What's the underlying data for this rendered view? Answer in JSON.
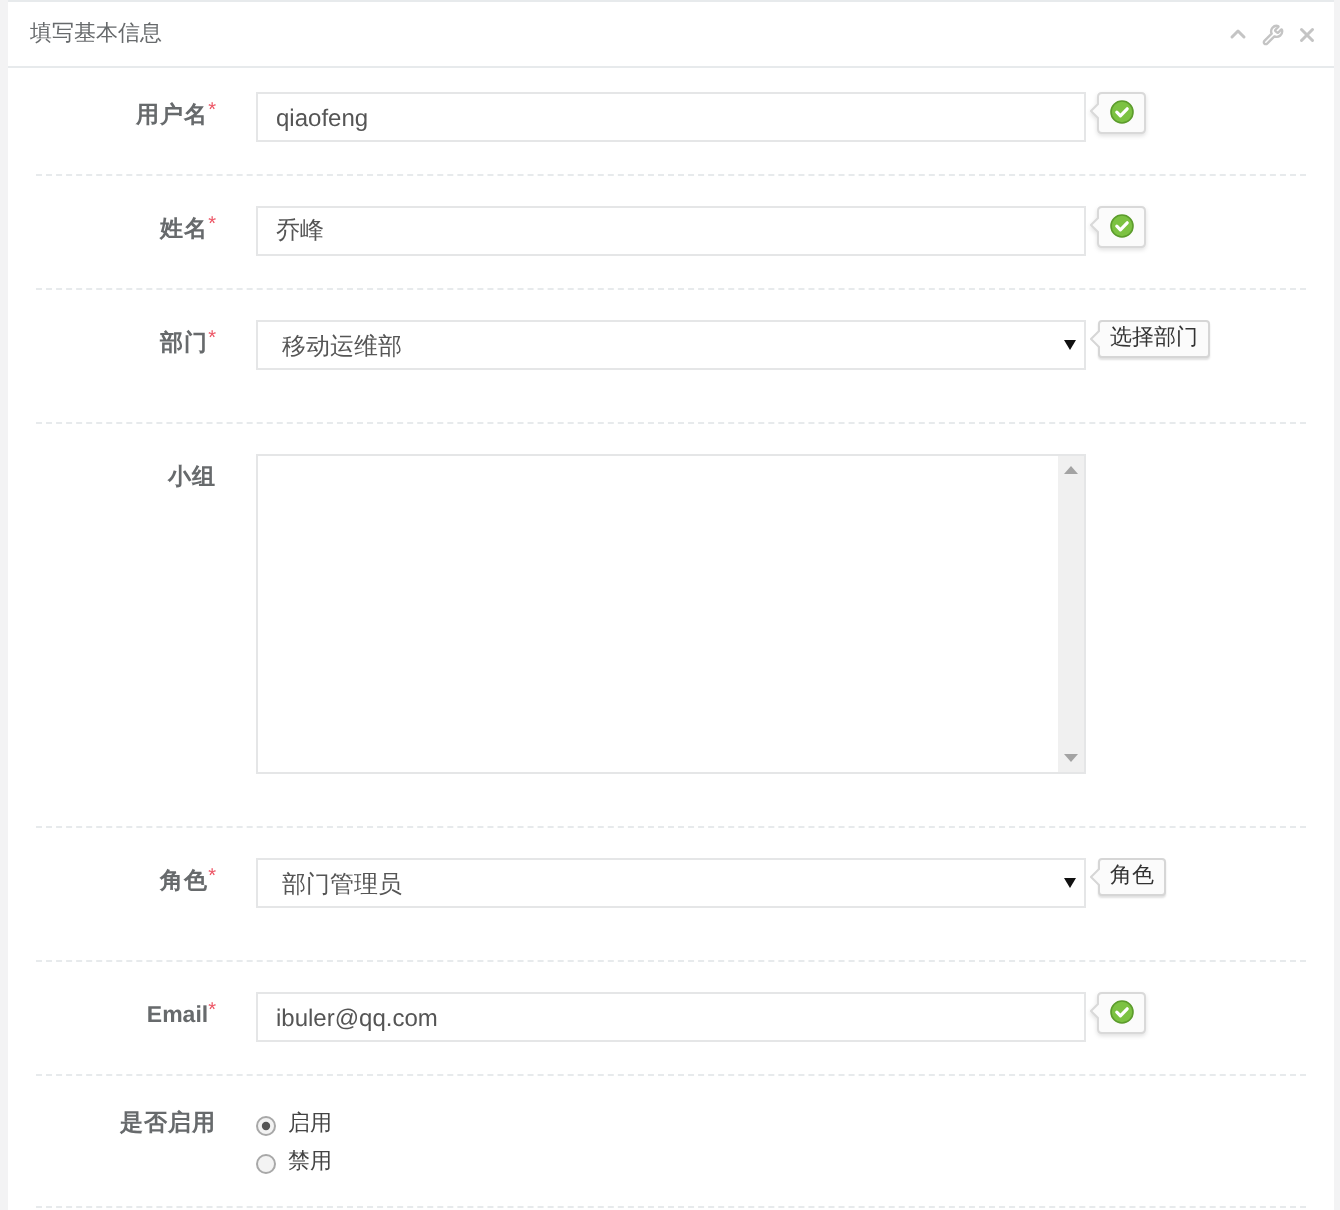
{
  "panel": {
    "title": "填写基本信息"
  },
  "fields": [
    {
      "kind": "text",
      "label": "用户名",
      "required_mark": "*",
      "value": "qiaofeng",
      "valid": true
    },
    {
      "kind": "text",
      "label": "姓名",
      "required_mark": "*",
      "value": "乔峰",
      "valid": true
    },
    {
      "kind": "select",
      "label": "部门",
      "required_mark": "*",
      "value": "移动运维部",
      "button": "选择部门"
    },
    {
      "kind": "textarea",
      "label": "小组"
    },
    {
      "kind": "select",
      "label": "角色",
      "required_mark": "*",
      "value": "部门管理员",
      "button": "角色"
    },
    {
      "kind": "text",
      "label": "Email",
      "required_mark": "*",
      "value": "ibuler@qq.com",
      "valid": true
    },
    {
      "kind": "radio",
      "label": "是否启用",
      "options": [
        {
          "label": "启用",
          "selected": true
        },
        {
          "label": "禁用",
          "selected": false
        }
      ]
    }
  ]
}
